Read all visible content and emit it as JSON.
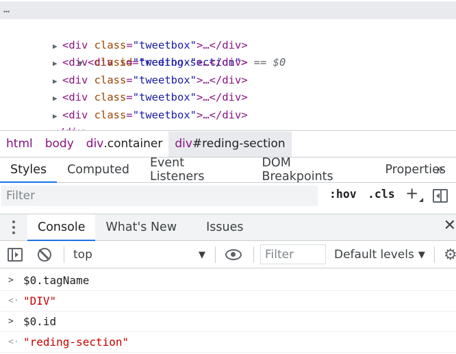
{
  "elements_tree": {
    "more_button": "…",
    "selected_node": {
      "tag_open": "<div",
      "attr_name": "id",
      "attr_value": "\"reding-section\"",
      "tag_close": ">",
      "equals_sel": " == $0"
    },
    "children": [
      {
        "tag_open": "<div",
        "attr_name": "class",
        "attr_value": "\"tweetbox\"",
        "collapsed": ">…</div>"
      },
      {
        "tag_open": "<div",
        "attr_name": "class",
        "attr_value": "\"tweetbox\"",
        "collapsed": ">…</div>"
      },
      {
        "tag_open": "<div",
        "attr_name": "class",
        "attr_value": "\"tweetbox\"",
        "collapsed": ">…</div>"
      },
      {
        "tag_open": "<div",
        "attr_name": "class",
        "attr_value": "\"tweetbox\"",
        "collapsed": ">…</div>"
      },
      {
        "tag_open": "<div",
        "attr_name": "class",
        "attr_value": "\"tweetbox\"",
        "collapsed": ">…</div>"
      }
    ],
    "closing_tag": "</div>"
  },
  "breadcrumb": [
    {
      "tag": "html",
      "rest": ""
    },
    {
      "tag": "body",
      "rest": ""
    },
    {
      "tag": "div",
      "rest": ".container"
    },
    {
      "tag": "div",
      "rest": "#reding-section"
    }
  ],
  "styles_tabs": [
    "Styles",
    "Computed",
    "Event Listeners",
    "DOM Breakpoints",
    "Properties"
  ],
  "styles_tabs_more": "»",
  "styles_filter": {
    "placeholder": "Filter",
    "hov": ":hov",
    "cls": ".cls",
    "plus": "+"
  },
  "drawer_tabs": [
    "Console",
    "What's New",
    "Issues"
  ],
  "drawer_close": "✕",
  "console_toolbar": {
    "context": "top",
    "filter_placeholder": "Filter",
    "levels": "Default levels"
  },
  "console_messages": [
    {
      "type": "input",
      "icon": ">",
      "text": "$0.tagName"
    },
    {
      "type": "output",
      "icon": "<·",
      "text": "\"DIV\""
    },
    {
      "type": "input",
      "icon": ">",
      "text": "$0.id"
    },
    {
      "type": "output",
      "icon": "<·",
      "text": "\"reding-section\""
    }
  ],
  "colors": {
    "tag": "#881280",
    "attr_name": "#994500",
    "attr_value": "#1a1aa6",
    "string_output": "#c80000",
    "active_tab": "#1a73e8"
  },
  "icons": {
    "expand": "triangle-down-icon",
    "collapse": "triangle-right-icon",
    "sidebar": "sidebar-icon",
    "clear": "clear-console-icon",
    "eye": "eye-icon",
    "settings": "gear-icon"
  }
}
